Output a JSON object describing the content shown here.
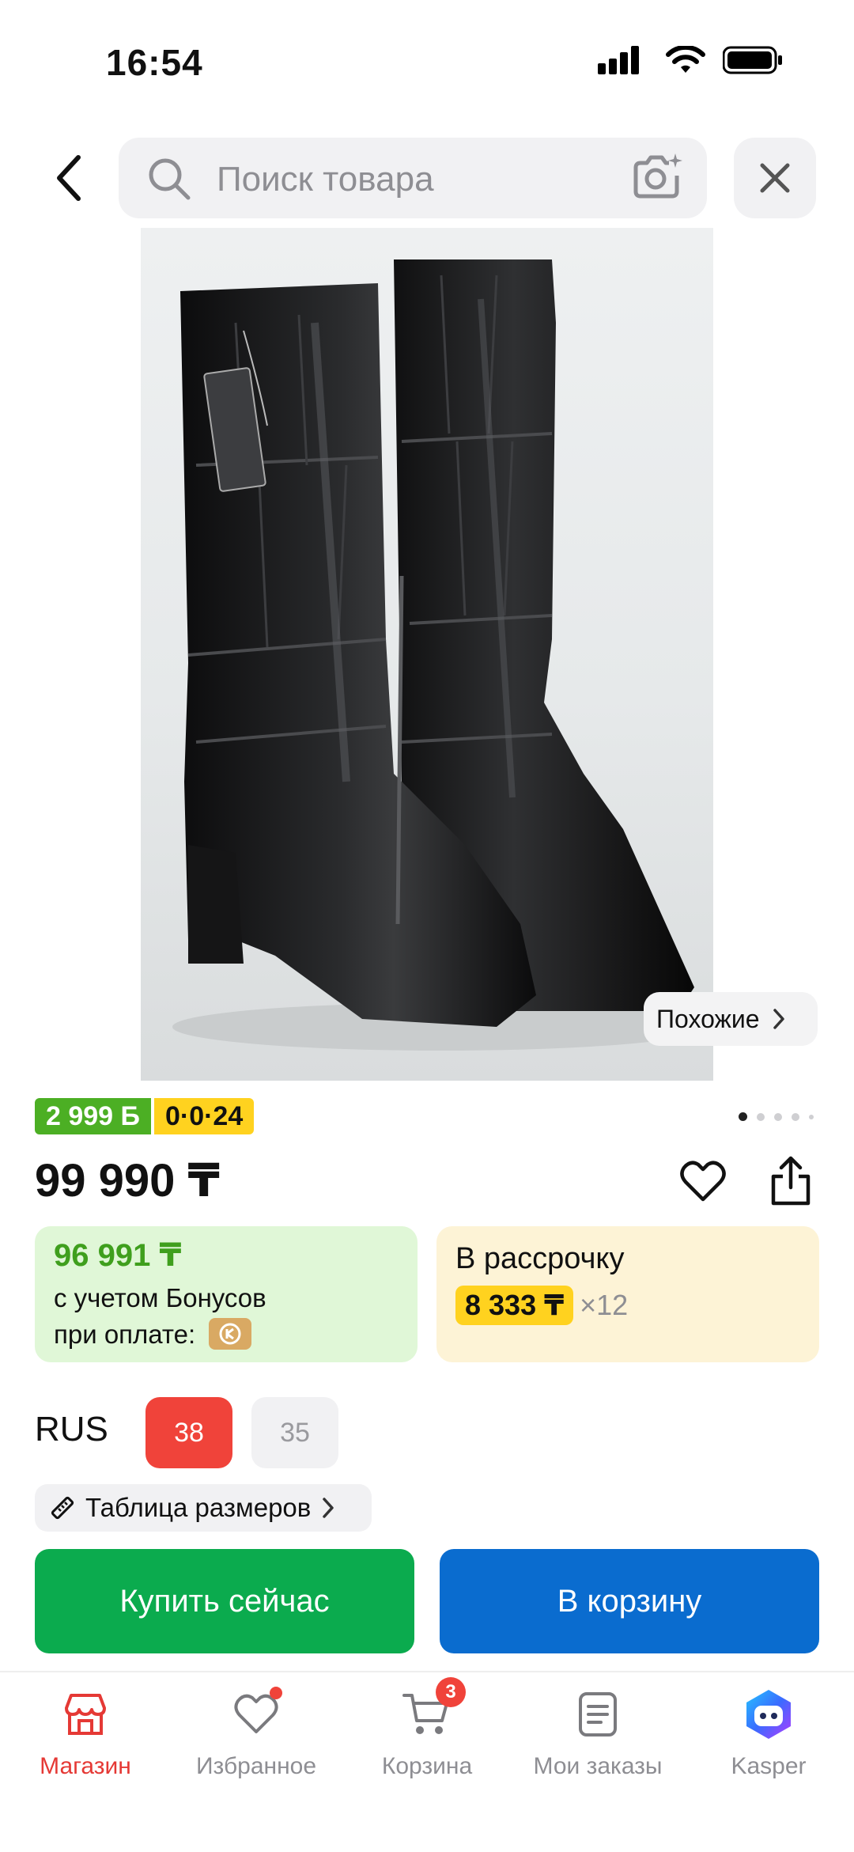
{
  "status_bar": {
    "time": "16:54"
  },
  "search": {
    "placeholder": "Поиск товара"
  },
  "product": {
    "similar_label": "Похожие",
    "bonus_badge": "2 999 Б",
    "installment_badge": "0·0·24",
    "price": "99 990 ₸",
    "gallery_total": 5,
    "gallery_index": 1
  },
  "bonus_card": {
    "price": "96 991 ₸",
    "line1": "с учетом Бонусов",
    "line2": "при оплате:"
  },
  "installment_card": {
    "title": "В рассрочку",
    "amount": "8 333 ₸",
    "term": "×12"
  },
  "sizes": {
    "system": "RUS",
    "options": [
      "38",
      "35"
    ],
    "selected": "38",
    "table_label": "Таблица размеров"
  },
  "actions": {
    "buy_label": "Купить сейчас",
    "cart_label": "В корзину"
  },
  "nav": {
    "items": [
      {
        "label": "Магазин",
        "icon": "shop-icon"
      },
      {
        "label": "Избранное",
        "icon": "heart-icon"
      },
      {
        "label": "Корзина",
        "icon": "cart-icon",
        "badge": "3"
      },
      {
        "label": "Мои заказы",
        "icon": "orders-icon"
      },
      {
        "label": "Kasper",
        "icon": "kasper-icon"
      }
    ]
  },
  "colors": {
    "accent_red": "#f0433a",
    "buy_green": "#0bab4e",
    "cart_blue": "#0a6ccf",
    "bonus_green": "#4caf24",
    "installment_yellow": "#ffd21f"
  }
}
